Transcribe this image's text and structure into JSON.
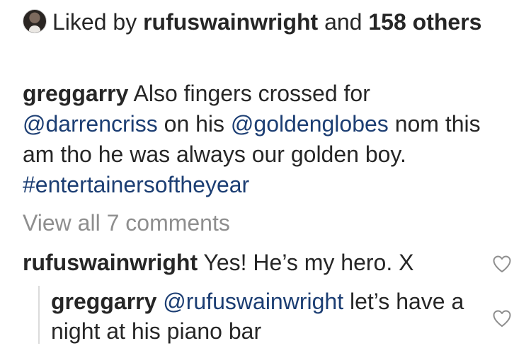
{
  "likes": {
    "prefix": "Liked by",
    "user": "rufuswainwright",
    "conj": "and",
    "count": "158",
    "suffix": "others",
    "avatar_icon": "user-avatar"
  },
  "caption": {
    "user": "greggarry",
    "text1": "Also fingers crossed for",
    "mention1": "@darrencriss",
    "text2": "on his",
    "mention2": "@goldenglobes",
    "text3": "nom this am tho he was always our golden boy.",
    "hashtag": "#entertainersoftheyear"
  },
  "view_all": "View all 7 comments",
  "comments": [
    {
      "user": "rufuswainwright",
      "text": "Yes!  He’s my hero. X",
      "icon": "heart-icon"
    }
  ],
  "replies": [
    {
      "user": "greggarry",
      "mention": "@rufuswainwright",
      "text": "let’s have a night at his piano bar",
      "icon": "heart-icon"
    }
  ],
  "colors": {
    "text": "#262626",
    "link": "#1c3e73",
    "muted": "#8e8e8e",
    "rule": "#dbdbdb"
  }
}
